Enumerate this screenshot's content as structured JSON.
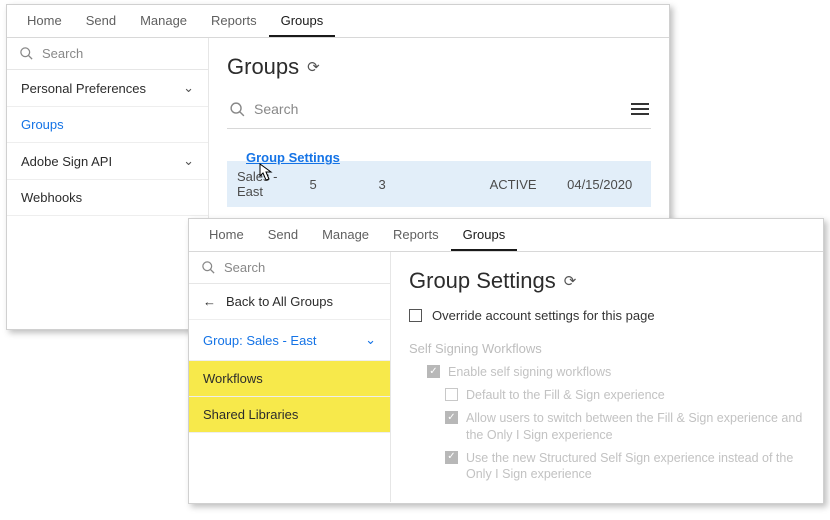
{
  "nav": {
    "items": [
      "Home",
      "Send",
      "Manage",
      "Reports",
      "Groups"
    ],
    "activeIndex": 4
  },
  "sidebar1": {
    "search": "Search",
    "items": [
      {
        "label": "Personal Preferences",
        "chevron": true
      },
      {
        "label": "Groups",
        "link": true
      },
      {
        "label": "Adobe Sign API",
        "chevron": true
      },
      {
        "label": "Webhooks"
      }
    ]
  },
  "page1": {
    "title": "Groups",
    "search": "Search",
    "tooltip": "Group Settings",
    "row": {
      "name": "Sales - East",
      "a": "5",
      "b": "3",
      "status": "ACTIVE",
      "date": "04/15/2020"
    }
  },
  "sidebar2": {
    "search": "Search",
    "back": "Back to All Groups",
    "group": "Group: Sales - East",
    "items": [
      "Workflows",
      "Shared Libraries"
    ]
  },
  "page2": {
    "title": "Group Settings",
    "override": "Override account settings for this page",
    "section": "Self Signing Workflows",
    "opts": {
      "o1": "Enable self signing workflows",
      "o2": "Default to the Fill & Sign experience",
      "o3": "Allow users to switch between the Fill & Sign experience and the Only I Sign experience",
      "o4": "Use the new Structured Self Sign experience instead of the Only I Sign experience"
    }
  }
}
